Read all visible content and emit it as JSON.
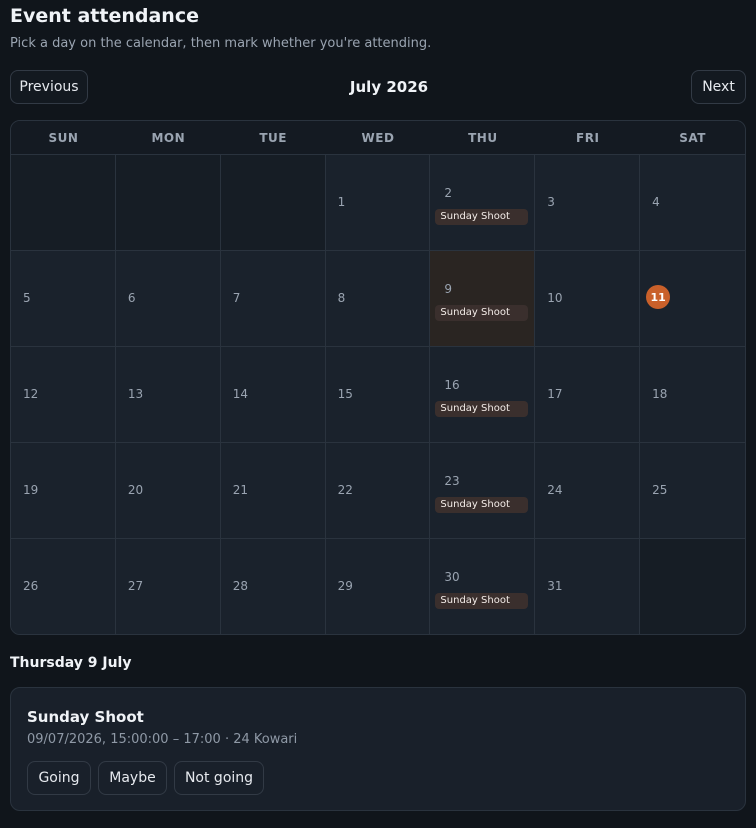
{
  "header": {
    "title": "Event attendance",
    "subtitle": "Pick a day on the calendar, then mark whether you're attending."
  },
  "nav": {
    "previous_label": "Previous",
    "next_label": "Next",
    "month_label": "July 2026"
  },
  "calendar": {
    "weekdays": [
      "SUN",
      "MON",
      "TUE",
      "WED",
      "THU",
      "FRI",
      "SAT"
    ],
    "leading_empty_days": 3,
    "days_in_month": 31,
    "today": 11,
    "selected_day": 9,
    "events": {
      "2": "Sunday Shoot",
      "9": "Sunday Shoot",
      "16": "Sunday Shoot",
      "23": "Sunday Shoot",
      "30": "Sunday Shoot"
    }
  },
  "selected": {
    "heading": "Thursday 9 July",
    "event": {
      "name": "Sunday Shoot",
      "details": "09/07/2026, 15:00:00 – 17:00 · 24 Kowari"
    },
    "rsvp": {
      "going": "Going",
      "maybe": "Maybe",
      "not_going": "Not going"
    }
  },
  "colors": {
    "background": "#10151b",
    "accent_today": "#c9602a",
    "event_chip": "#3a2f2d",
    "selected_cell": "#2a2522"
  }
}
